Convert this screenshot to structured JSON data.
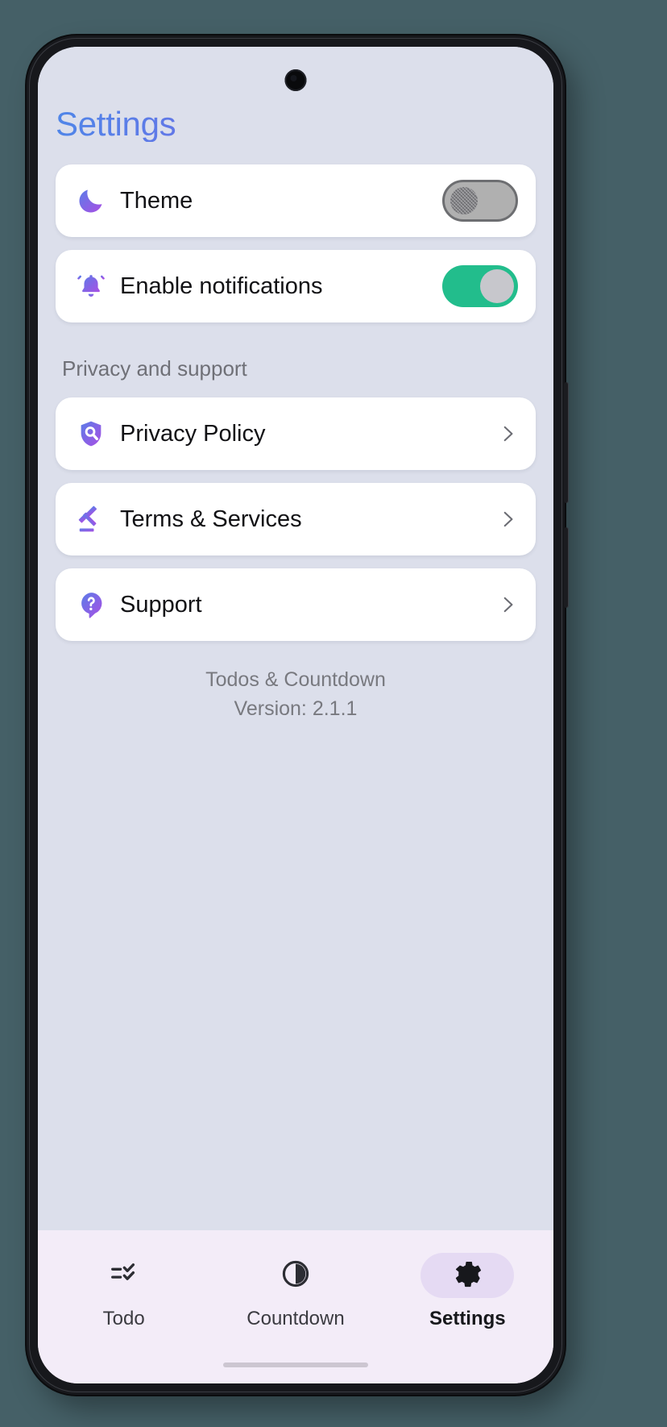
{
  "app": {
    "title": "Settings",
    "footer_name": "Todos & Countdown",
    "footer_version": "Version: 2.1.1",
    "accent_gradient_start": "#4f86e8",
    "accent_gradient_end": "#a855e8",
    "toggle_on_color": "#22bd8c",
    "toggle_off_color": "#b0b0b0",
    "screen_background": "#dcdfeb",
    "card_background": "#ffffff",
    "nav_background": "#f3ecf8",
    "nav_active_pill": "#e5daf3"
  },
  "settings_rows": [
    {
      "label": "Theme",
      "icon": "moon-icon",
      "control": "toggle",
      "state": "off"
    },
    {
      "label": "Enable notifications",
      "icon": "bell-icon",
      "control": "toggle",
      "state": "on"
    }
  ],
  "section": {
    "header": "Privacy and support"
  },
  "link_rows": [
    {
      "label": "Privacy Policy",
      "icon": "shield-search-icon",
      "chevron": "chevron-right-icon"
    },
    {
      "label": "Terms & Services",
      "icon": "gavel-icon",
      "chevron": "chevron-right-icon"
    },
    {
      "label": "Support",
      "icon": "question-bubble-icon",
      "chevron": "chevron-right-icon"
    }
  ],
  "bottom_nav": {
    "items": [
      {
        "label": "Todo",
        "icon": "checklist-icon",
        "active": false
      },
      {
        "label": "Countdown",
        "icon": "pie-clock-icon",
        "active": false
      },
      {
        "label": "Settings",
        "icon": "gear-icon",
        "active": true
      }
    ]
  }
}
